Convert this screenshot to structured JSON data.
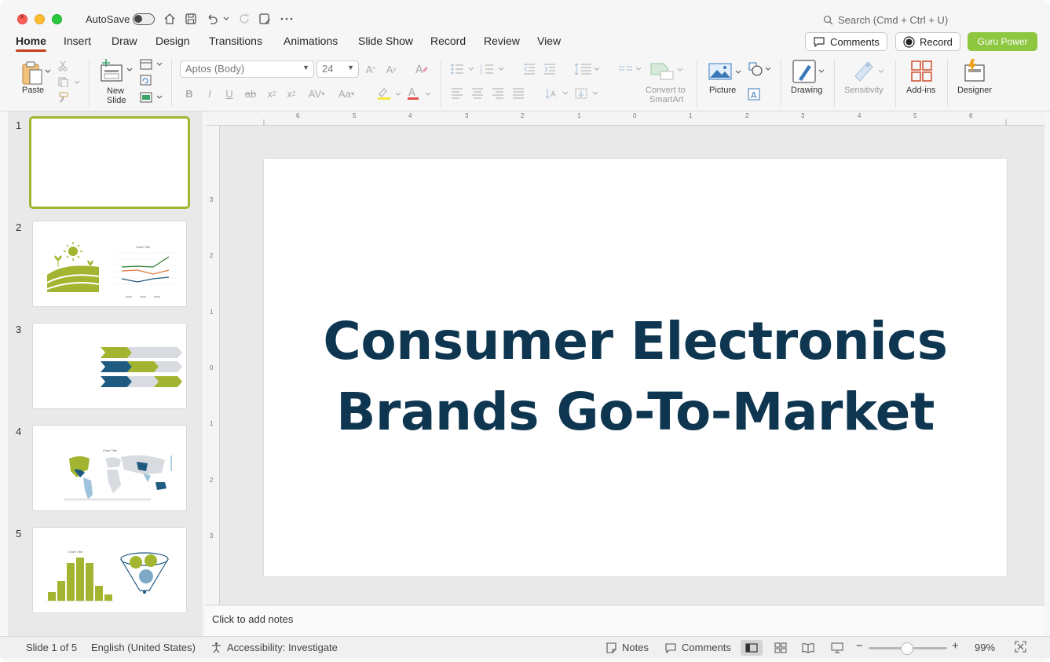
{
  "titlebar": {
    "autosave_label": "AutoSave",
    "search_placeholder": "Search (Cmd + Ctrl + U)"
  },
  "tabs": [
    "Home",
    "Insert",
    "Draw",
    "Design",
    "Transitions",
    "Animations",
    "Slide Show",
    "Record",
    "Review",
    "View"
  ],
  "actions": {
    "comments": "Comments",
    "record": "Record",
    "guru": "Guru Power"
  },
  "ribbon": {
    "paste": "Paste",
    "new_slide_1": "New",
    "new_slide_2": "Slide",
    "font_name": "Aptos (Body)",
    "font_size": "24",
    "convert_1": "Convert to",
    "convert_2": "SmartArt",
    "picture": "Picture",
    "drawing": "Drawing",
    "sensitivity": "Sensitivity",
    "addins": "Add-ins",
    "designer": "Designer"
  },
  "thumbnails": {
    "numbers": [
      "1",
      "2",
      "3",
      "4",
      "5"
    ],
    "chart_title_2": "Chart Title",
    "chart_title_4": "Chart Title",
    "chart_title_5": "Chart Title"
  },
  "slide": {
    "title_line1": "Consumer Electronics",
    "title_line2": "Brands Go-To-Market"
  },
  "rulers": {
    "top": [
      "6",
      "5",
      "4",
      "3",
      "2",
      "1",
      "0",
      "1",
      "2",
      "3",
      "4",
      "5",
      "6"
    ],
    "left": [
      "3",
      "2",
      "1",
      "0",
      "1",
      "2",
      "3"
    ]
  },
  "notes": {
    "placeholder": "Click to add notes"
  },
  "status": {
    "slide_of": "Slide 1 of 5",
    "language": "English (United States)",
    "accessibility": "Accessibility: Investigate",
    "notes": "Notes",
    "comments": "Comments",
    "zoom": "99%"
  },
  "colors": {
    "accent_red": "#c43e1c",
    "title_navy": "#0e3650",
    "brand_green": "#8dc63f",
    "thumb_green": "#a3b530",
    "thumb_blue": "#1f5a80"
  }
}
